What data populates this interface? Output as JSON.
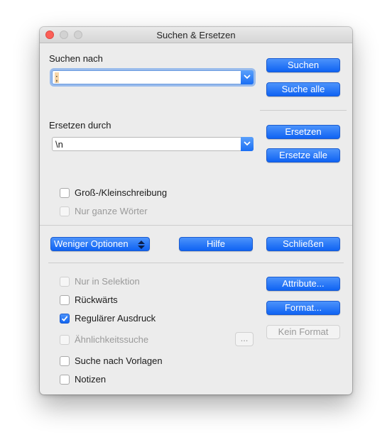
{
  "window": {
    "title": "Suchen & Ersetzen"
  },
  "search": {
    "label": "Suchen nach",
    "value": ";",
    "search_button": "Suchen",
    "search_all_button": "Suche alle"
  },
  "replace": {
    "label": "Ersetzen durch",
    "value": "\\n",
    "replace_button": "Ersetzen",
    "replace_all_button": "Ersetze alle"
  },
  "options": {
    "match_case": {
      "label": "Groß-/Kleinschreibung",
      "checked": false,
      "enabled": true
    },
    "whole_words": {
      "label": "Nur ganze Wörter",
      "checked": false,
      "enabled": false
    }
  },
  "actions": {
    "fewer_options": "Weniger Optionen",
    "help": "Hilfe",
    "close": "Schließen"
  },
  "more_options": {
    "selection_only": {
      "label": "Nur in Selektion",
      "checked": false,
      "enabled": false
    },
    "backwards": {
      "label": "Rückwärts",
      "checked": false,
      "enabled": true
    },
    "regex": {
      "label": "Regulärer Ausdruck",
      "checked": true,
      "enabled": true
    },
    "similarity": {
      "label": "Ähnlichkeitssuche",
      "checked": false,
      "enabled": false
    },
    "similarity_button": "...",
    "styles": {
      "label": "Suche nach Vorlagen",
      "checked": false,
      "enabled": true
    },
    "notes": {
      "label": "Notizen",
      "checked": false,
      "enabled": true
    },
    "attributes_button": "Attribute...",
    "format_button": "Format...",
    "no_format_button": "Kein Format"
  },
  "colors": {
    "accent": "#1a6ef4",
    "window_bg": "#ececec"
  }
}
